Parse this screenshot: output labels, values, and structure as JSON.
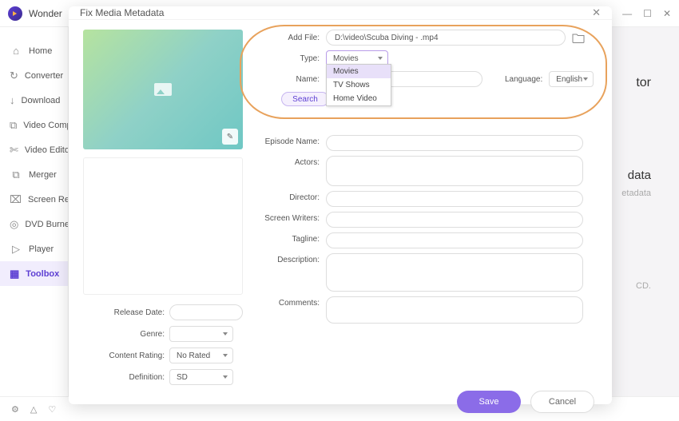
{
  "app": {
    "title": "Wonder"
  },
  "win": {
    "min": "—",
    "max": "☐",
    "close": "✕"
  },
  "sidebar": {
    "items": [
      {
        "label": "Home",
        "icon": "⌂"
      },
      {
        "label": "Converter",
        "icon": "↻"
      },
      {
        "label": "Download",
        "icon": "↓"
      },
      {
        "label": "Video Compressor",
        "icon": "⧉"
      },
      {
        "label": "Video Editor",
        "icon": "✄"
      },
      {
        "label": "Merger",
        "icon": "⧉"
      },
      {
        "label": "Screen Recorder",
        "icon": "⌧"
      },
      {
        "label": "DVD Burner",
        "icon": "◎"
      },
      {
        "label": "Player",
        "icon": "▷"
      },
      {
        "label": "Toolbox",
        "icon": "▦"
      }
    ]
  },
  "bg": {
    "l1": "tor",
    "l2": "data",
    "l3": "etadata",
    "l4": "CD."
  },
  "status": {
    "settings": "⚙",
    "bell": "△",
    "fav": "♡"
  },
  "modal": {
    "title": "Fix Media Metadata",
    "addfile_label": "Add File:",
    "addfile_value": "D:\\video\\Scuba Diving - .mp4",
    "type_label": "Type:",
    "type_value": "Movies",
    "type_options": [
      "Movies",
      "TV Shows",
      "Home Video"
    ],
    "name_label": "Name:",
    "lang_label": "Language:",
    "lang_value": "English",
    "search": "Search",
    "episode_label": "Episode Name:",
    "actors_label": "Actors:",
    "director_label": "Director:",
    "writers_label": "Screen Writers:",
    "tagline_label": "Tagline:",
    "desc_label": "Description:",
    "comments_label": "Comments:",
    "release_label": "Release Date:",
    "genre_label": "Genre:",
    "rating_label": "Content Rating:",
    "rating_value": "No Rated",
    "def_label": "Definition:",
    "def_value": "SD",
    "save": "Save",
    "cancel": "Cancel"
  }
}
